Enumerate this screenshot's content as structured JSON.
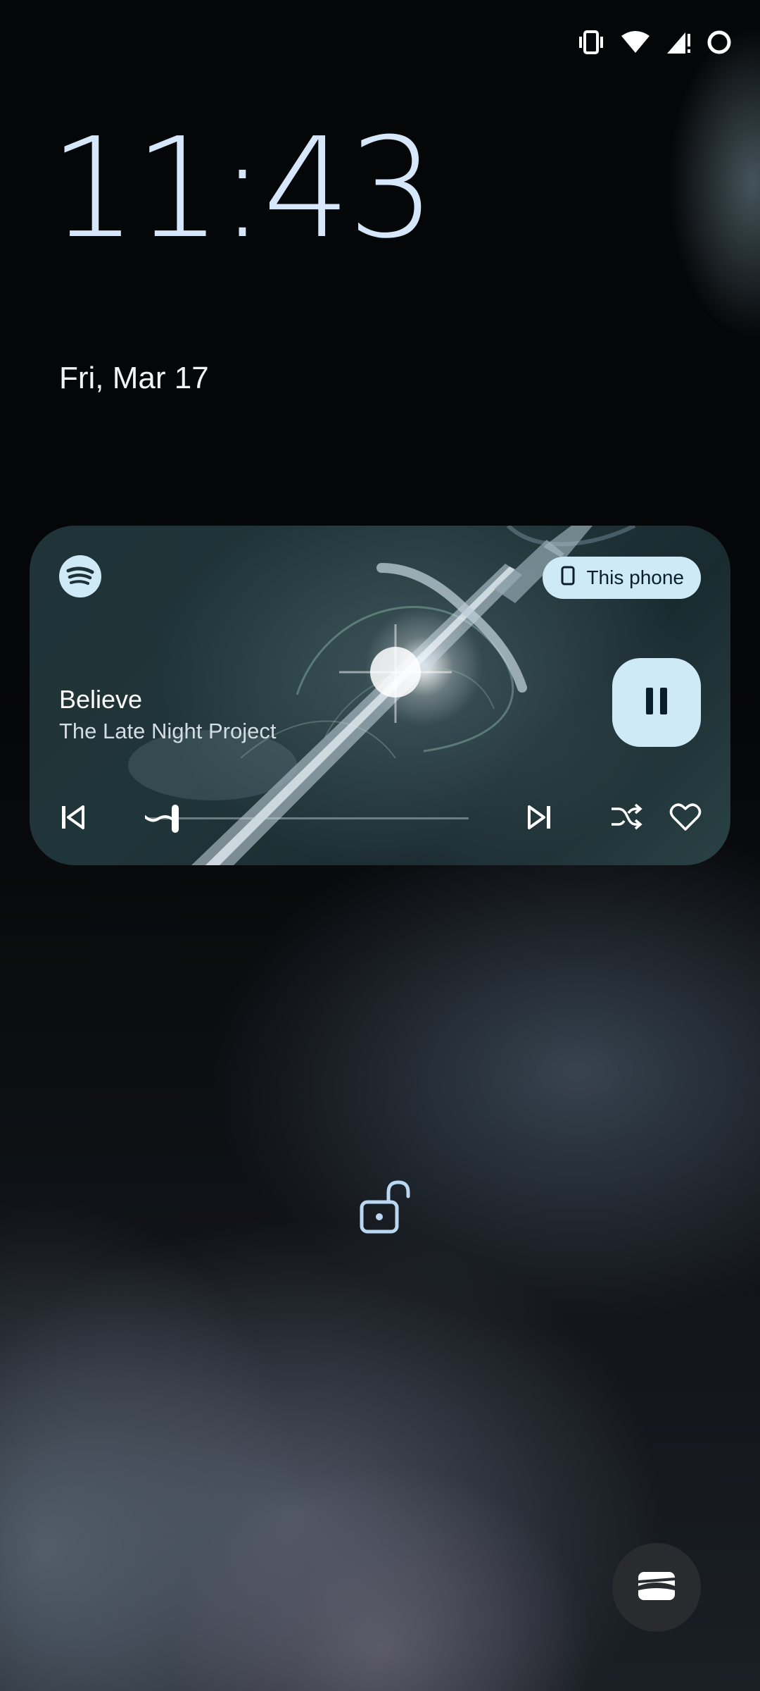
{
  "status_bar": {
    "icons": [
      "vibrate-icon",
      "wifi-icon",
      "signal-icon",
      "battery-icon"
    ]
  },
  "lockscreen": {
    "time": "11:43",
    "date": "Fri, Mar 17"
  },
  "media": {
    "app_icon": "spotify-icon",
    "output_device_label": "This phone",
    "title": "Believe",
    "artist": "The Late Night Project",
    "progress": 0.05,
    "controls": [
      "previous-icon",
      "pause-icon",
      "next-icon",
      "shuffle-icon",
      "heart-icon"
    ]
  },
  "colors": {
    "clock": "#d6e7fb",
    "accent_chip": "#cfeaf7",
    "wallet_bg": "#2a2b2e"
  },
  "bottom": {
    "unlock_icon": "unlock-icon",
    "wallet_icon": "wallet-icon"
  }
}
